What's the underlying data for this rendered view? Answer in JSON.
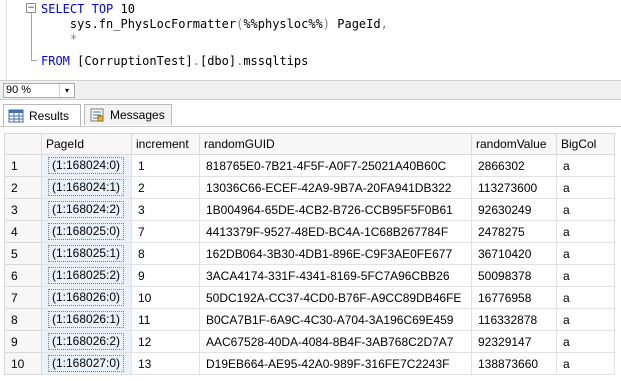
{
  "editor": {
    "lines": [
      {
        "parts": [
          {
            "cls": "kw",
            "t": "SELECT"
          },
          {
            "cls": "ident",
            "t": " "
          },
          {
            "cls": "kw",
            "t": "TOP"
          },
          {
            "cls": "ident",
            "t": " 10"
          }
        ]
      },
      {
        "parts": [
          {
            "cls": "ident",
            "t": "    sys.fn_PhysLocFormatter"
          },
          {
            "cls": "grey",
            "t": "("
          },
          {
            "cls": "ident",
            "t": "%%physloc%%"
          },
          {
            "cls": "grey",
            "t": ")"
          },
          {
            "cls": "ident",
            "t": " PageId"
          },
          {
            "cls": "grey",
            "t": ","
          }
        ]
      },
      {
        "parts": [
          {
            "cls": "ident",
            "t": "    "
          },
          {
            "cls": "grey",
            "t": "*"
          }
        ]
      },
      {
        "parts": [
          {
            "cls": "kw",
            "t": "FROM"
          },
          {
            "cls": "ident",
            "t": " [CorruptionTest]"
          },
          {
            "cls": "grey",
            "t": "."
          },
          {
            "cls": "ident",
            "t": "[dbo]"
          },
          {
            "cls": "grey",
            "t": "."
          },
          {
            "cls": "ident",
            "t": "mssqltips"
          }
        ]
      }
    ],
    "collapse_symbol": "−"
  },
  "zoom": {
    "value": "90 %",
    "arrow": "▾"
  },
  "tabs": {
    "results": "Results",
    "messages": "Messages"
  },
  "grid": {
    "columns": [
      "PageId",
      "increment",
      "randomGUID",
      "randomValue",
      "BigCol"
    ],
    "rows": [
      [
        "1",
        "(1:168024:0)",
        "1",
        "818765E0-7B21-4F5F-A0F7-25021A40B60C",
        "2866302",
        "a"
      ],
      [
        "2",
        "(1:168024:1)",
        "2",
        "13036C66-ECEF-42A9-9B7A-20FA941DB322",
        "113273600",
        "a"
      ],
      [
        "3",
        "(1:168024:2)",
        "3",
        "1B004964-65DE-4CB2-B726-CCB95F5F0B61",
        "92630249",
        "a"
      ],
      [
        "4",
        "(1:168025:0)",
        "7",
        "4413379F-9527-48ED-BC4A-1C68B267784F",
        "2478275",
        "a"
      ],
      [
        "5",
        "(1:168025:1)",
        "8",
        "162DB064-3B30-4DB1-896E-C9F3AE0FE677",
        "36710420",
        "a"
      ],
      [
        "6",
        "(1:168025:2)",
        "9",
        "3ACA4174-331F-4341-8169-5FC7A96CBB26",
        "50098378",
        "a"
      ],
      [
        "7",
        "(1:168026:0)",
        "10",
        "50DC192A-CC37-4CD0-B76F-A9CC89DB46FE",
        "16776958",
        "a"
      ],
      [
        "8",
        "(1:168026:1)",
        "11",
        "B0CA7B1F-6A9C-4C30-A704-3A196C69E459",
        "116332878",
        "a"
      ],
      [
        "9",
        "(1:168026:2)",
        "12",
        "AAC67528-40DA-4084-8B4F-3AB768C2D7A7",
        "92329147",
        "a"
      ],
      [
        "10",
        "(1:168027:0)",
        "13",
        "D19EB664-AE95-42A0-989F-316FE7C2243F",
        "138873660",
        "a"
      ]
    ]
  },
  "colors": {
    "keyword": "#0000ff",
    "operator": "#808080",
    "selected_cell": "#eaf2fb"
  },
  "icons": {
    "results_tab": "grid-icon",
    "messages_tab": "messages-icon"
  }
}
